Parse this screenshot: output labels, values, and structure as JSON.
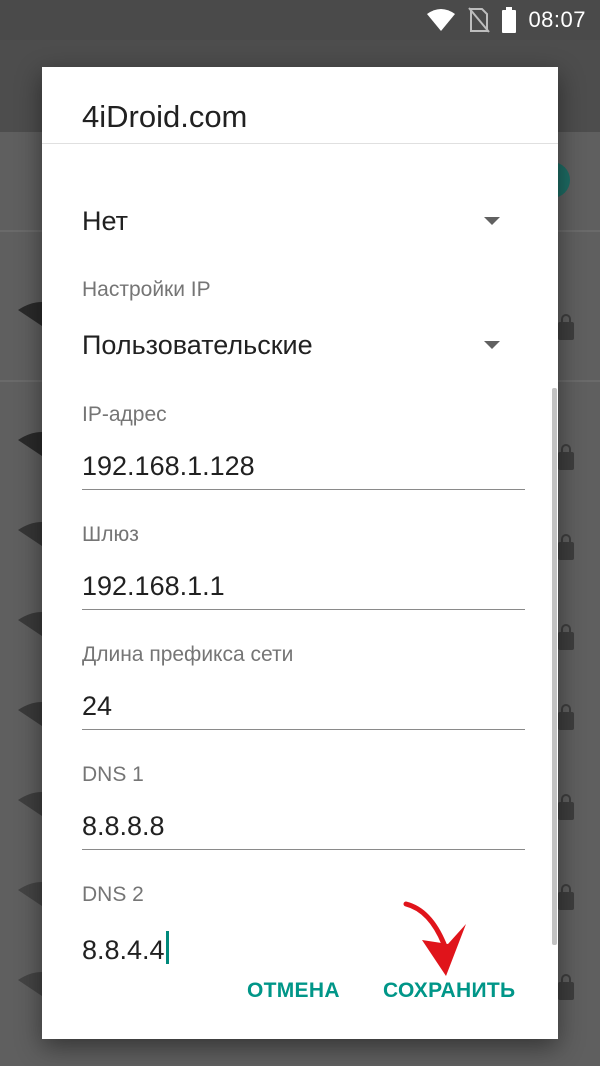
{
  "status_bar": {
    "time": "08:07",
    "icons": [
      "wifi-icon",
      "no-sim-icon",
      "battery-icon"
    ]
  },
  "dialog": {
    "title": "4iDroid.com",
    "proxy_value": "Нет",
    "ip_settings": {
      "label": "Настройки IP",
      "value": "Пользовательские"
    },
    "fields": [
      {
        "label": "IP-адрес",
        "value": "192.168.1.128"
      },
      {
        "label": "Шлюз",
        "value": "192.168.1.1"
      },
      {
        "label": "Длина префикса сети",
        "value": "24"
      },
      {
        "label": "DNS 1",
        "value": "8.8.8.8"
      },
      {
        "label": "DNS 2",
        "value": "8.8.4.4"
      }
    ],
    "buttons": {
      "cancel": "ОТМЕНА",
      "save": "СОХРАНИТЬ"
    }
  },
  "colors": {
    "accent": "#009688",
    "scrim": "#5f5f5f",
    "annotation_arrow": "#e0141b"
  }
}
